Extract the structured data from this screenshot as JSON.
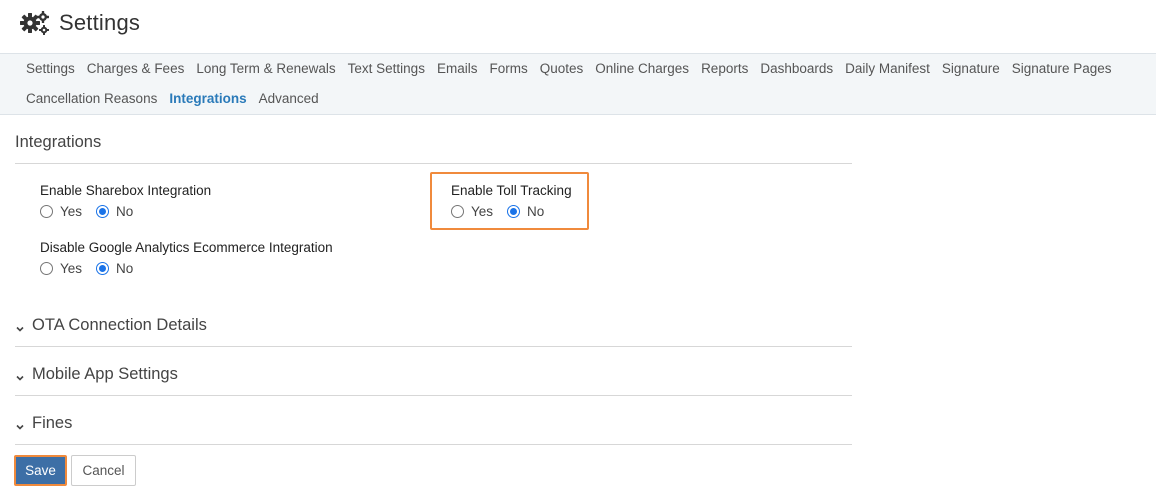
{
  "header": {
    "title": "Settings",
    "icon": "gears-icon"
  },
  "subnav": {
    "row1": [
      "Settings",
      "Charges & Fees",
      "Long Term & Renewals",
      "Text Settings",
      "Emails",
      "Forms",
      "Quotes",
      "Online Charges",
      "Reports",
      "Dashboards",
      "Daily Manifest",
      "Signature",
      "Signature Pages"
    ],
    "row2": [
      "Cancellation Reasons",
      "Integrations",
      "Advanced"
    ],
    "active": "Integrations"
  },
  "integrations": {
    "heading": "Integrations",
    "sharebox": {
      "label": "Enable Sharebox Integration",
      "yes": "Yes",
      "no": "No",
      "selected": "No"
    },
    "toll": {
      "label": "Enable Toll Tracking",
      "yes": "Yes",
      "no": "No",
      "selected": "No"
    },
    "analytics": {
      "label": "Disable Google Analytics Ecommerce Integration",
      "yes": "Yes",
      "no": "No",
      "selected": "No"
    }
  },
  "accordions": {
    "ota": "OTA Connection Details",
    "mobile": "Mobile App Settings",
    "fines": "Fines"
  },
  "actions": {
    "save": "Save",
    "cancel": "Cancel"
  },
  "colors": {
    "accent": "#2a7ab9",
    "highlight": "#f08a3c",
    "save_button": "#3d6fa6",
    "radio": "#1a73e8"
  }
}
